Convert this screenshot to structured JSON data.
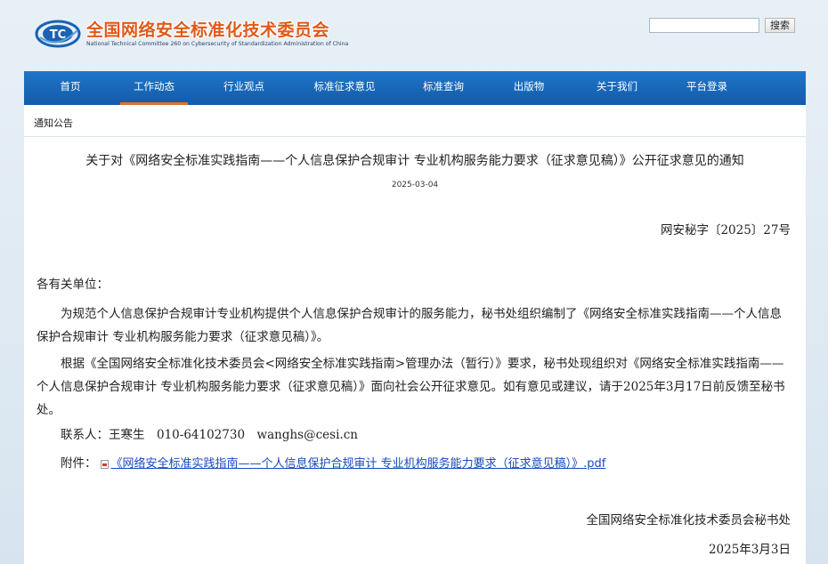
{
  "header": {
    "logo_cn": "全国网络安全标准化技术委员会",
    "logo_en": "National Technical Committee 260 on Cybersecurity of Standardization Administration of China",
    "search_placeholder": "",
    "search_button": "搜索"
  },
  "nav": {
    "items": [
      {
        "label": "首页"
      },
      {
        "label": "工作动态"
      },
      {
        "label": "行业观点"
      },
      {
        "label": "标准征求意见"
      },
      {
        "label": "标准查询"
      },
      {
        "label": "出版物"
      },
      {
        "label": "关于我们"
      },
      {
        "label": "平台登录"
      }
    ],
    "active_index": 1
  },
  "breadcrumb": "通知公告",
  "article": {
    "title": "关于对《网络安全标准实践指南——个人信息保护合规审计 专业机构服务能力要求（征求意见稿）》公开征求意见的通知",
    "date": "2025-03-04",
    "doc_number": "网安秘字〔2025〕27号",
    "salutation": "各有关单位：",
    "paragraph1": "为规范个人信息保护合规审计专业机构提供个人信息保护合规审计的服务能力，秘书处组织编制了《网络安全标准实践指南——个人信息保护合规审计 专业机构服务能力要求（征求意见稿）》。",
    "paragraph2": "根据《全国网络安全标准化技术委员会<网络安全标准实践指南>管理办法（暂行）》要求，秘书处现组织对《网络安全标准实践指南——个人信息保护合规审计 专业机构服务能力要求（征求意见稿）》面向社会公开征求意见。如有意见或建议，请于2025年3月17日前反馈至秘书处。",
    "contact": "联系人：王寒生　010-64102730　wanghs@cesi.cn",
    "attachment_label": "附件：",
    "attachment_link": "《网络安全标准实践指南——个人信息保护合规审计 专业机构服务能力要求（征求意见稿）》.pdf",
    "signature_org": "全国网络安全标准化技术委员会秘书处",
    "signature_date": "2025年3月3日"
  },
  "colors": {
    "nav_bg": "#1a68bb",
    "nav_active_underline": "#e0742a",
    "logo_text": "#e05a1a",
    "link": "#1a48c0"
  }
}
